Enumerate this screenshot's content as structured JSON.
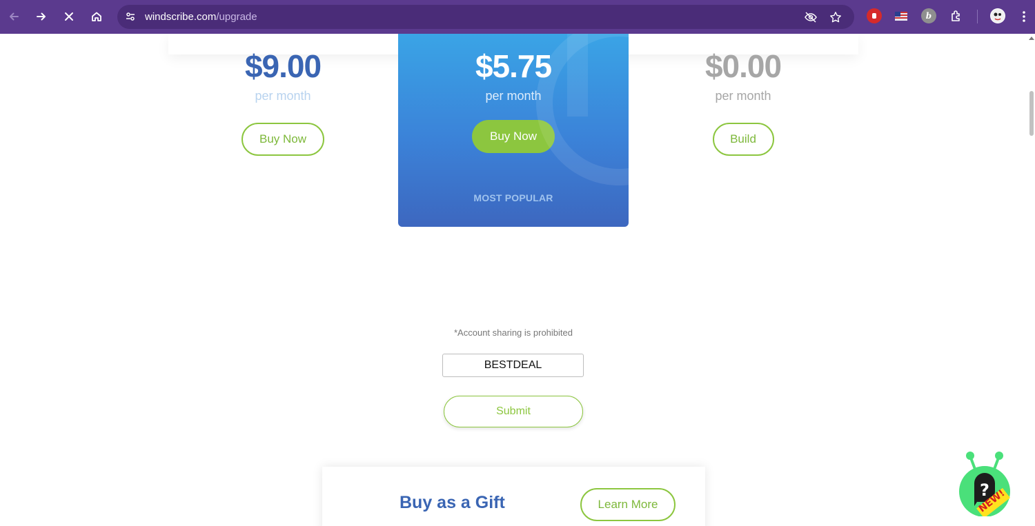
{
  "browser": {
    "url_host": "windscribe.com",
    "url_path": "/upgrade"
  },
  "plans": [
    {
      "price": "$9.00",
      "period": "per month",
      "button": "Buy Now"
    },
    {
      "price": "$5.75",
      "period": "per month",
      "button": "Buy Now",
      "badge": "MOST POPULAR"
    },
    {
      "price": "$0.00",
      "period": "per month",
      "button": "Build"
    }
  ],
  "promo": {
    "notice": "*Account sharing is prohibited",
    "code_value": "BESTDEAL",
    "submit_label": "Submit"
  },
  "gift": {
    "title": "Buy as a Gift",
    "button": "Learn More"
  },
  "help_widget": {
    "badge": "NEW!",
    "icon": "question-bubble-icon"
  },
  "colors": {
    "chrome": "#5b3a8e",
    "brand_blue": "#3a65b3",
    "accent_green": "#8cc63f"
  }
}
